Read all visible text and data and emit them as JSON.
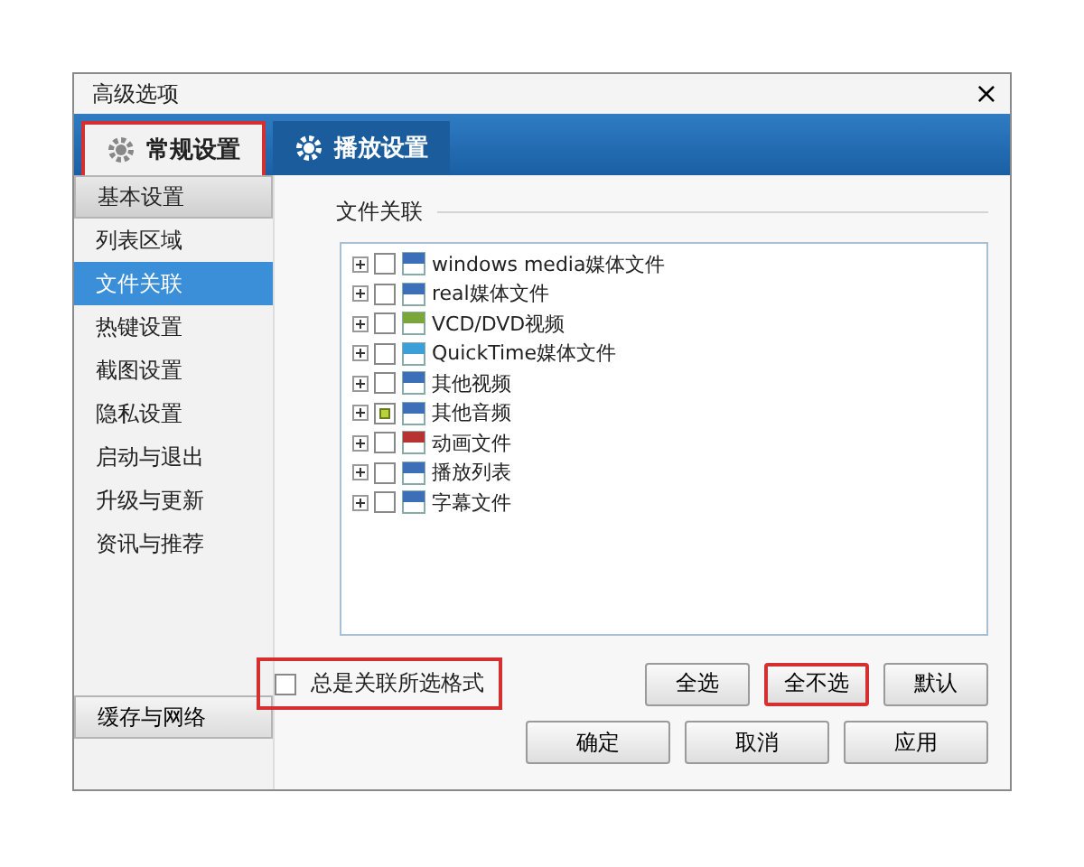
{
  "window": {
    "title": "高级选项",
    "close": "×"
  },
  "tabs": [
    {
      "label": "常规设置",
      "selected": true,
      "highlighted": true
    },
    {
      "label": "播放设置",
      "selected": false,
      "highlighted": false
    }
  ],
  "sidebar": {
    "items": [
      {
        "label": "基本设置",
        "kind": "header",
        "selected": false
      },
      {
        "label": "列表区域",
        "kind": "item",
        "selected": false
      },
      {
        "label": "文件关联",
        "kind": "item",
        "selected": true
      },
      {
        "label": "热键设置",
        "kind": "item",
        "selected": false
      },
      {
        "label": "截图设置",
        "kind": "item",
        "selected": false
      },
      {
        "label": "隐私设置",
        "kind": "item",
        "selected": false
      },
      {
        "label": "启动与退出",
        "kind": "item",
        "selected": false
      },
      {
        "label": "升级与更新",
        "kind": "item",
        "selected": false
      },
      {
        "label": "资讯与推荐",
        "kind": "item",
        "selected": false
      }
    ],
    "bottom_button": "缓存与网络"
  },
  "group": {
    "title": "文件关联",
    "tree": [
      {
        "label": "windows media媒体文件",
        "partial": false,
        "color": "#3d6fb8"
      },
      {
        "label": "real媒体文件",
        "partial": false,
        "color": "#3d6fb8"
      },
      {
        "label": "VCD/DVD视频",
        "partial": false,
        "color": "#7aa63a"
      },
      {
        "label": "QuickTime媒体文件",
        "partial": false,
        "color": "#3d9fd8"
      },
      {
        "label": "其他视频",
        "partial": false,
        "color": "#3d6fb8"
      },
      {
        "label": "其他音频",
        "partial": true,
        "color": "#3d6fb8"
      },
      {
        "label": "动画文件",
        "partial": false,
        "color": "#b83232"
      },
      {
        "label": "播放列表",
        "partial": false,
        "color": "#3d6fb8"
      },
      {
        "label": "字幕文件",
        "partial": false,
        "color": "#3d6fb8"
      }
    ]
  },
  "always_associate": {
    "label": "总是关联所选格式",
    "checked": false,
    "highlighted": true
  },
  "select_buttons": [
    {
      "label": "全选",
      "highlighted": false
    },
    {
      "label": "全不选",
      "highlighted": true
    },
    {
      "label": "默认",
      "highlighted": false
    }
  ],
  "dialog_buttons": [
    "确定",
    "取消",
    "应用"
  ]
}
